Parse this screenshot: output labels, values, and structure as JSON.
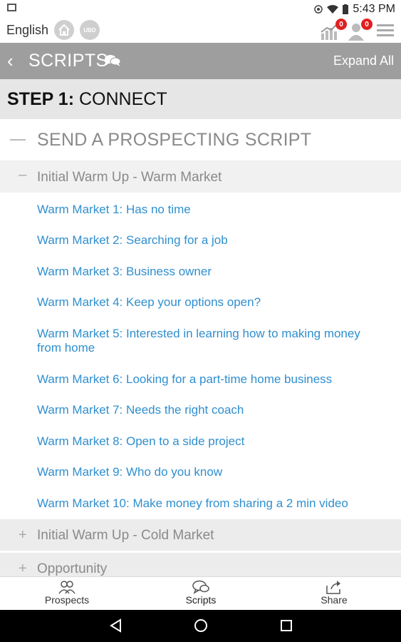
{
  "status_bar": {
    "time": "5:43 PM"
  },
  "header": {
    "language": "English",
    "ubd_label": "UBD",
    "stats_badge": "0",
    "alerts_badge": "0"
  },
  "titlebar": {
    "title": "SCRIPTS",
    "expand_all": "Expand All"
  },
  "step": {
    "prefix": "STEP 1:",
    "title": "CONNECT"
  },
  "section": {
    "title": "SEND A PROSPECTING SCRIPT"
  },
  "subsections": [
    {
      "label": "Initial Warm Up - Warm Market",
      "expanded": true
    },
    {
      "label": "Initial Warm Up - Cold Market",
      "expanded": false
    },
    {
      "label": "Opportunity",
      "expanded": false
    }
  ],
  "scripts": [
    "Warm Market 1:  Has no time",
    "Warm Market 2:  Searching for a job",
    "Warm Market 3:  Business owner",
    "Warm Market 4:  Keep your options open?",
    "Warm Market 5:  Interested in learning how to making money from home",
    "Warm Market 6:  Looking for a part-time home business",
    "Warm Market 7:  Needs the right coach",
    "Warm Market 8:  Open to a side project",
    "Warm Market 9:  Who do you know",
    "Warm Market 10:  Make money from sharing a 2 min video"
  ],
  "bottom_nav": [
    {
      "label": "Prospects",
      "icon": "people-icon"
    },
    {
      "label": "Scripts",
      "icon": "chat-icon",
      "active": true
    },
    {
      "label": "Share",
      "icon": "share-icon"
    }
  ],
  "colors": {
    "link": "#2f8fcf",
    "titlebar": "#9e9e9e",
    "badge": "#e02020"
  }
}
